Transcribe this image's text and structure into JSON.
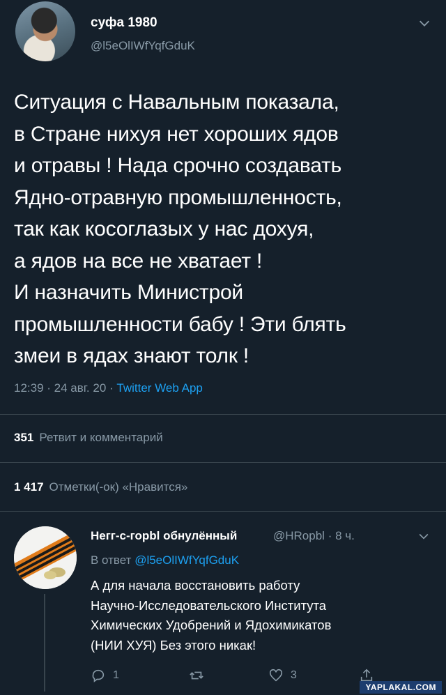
{
  "tweet": {
    "author_name": "суфа 1980",
    "author_handle": "@l5eOlIWfYqfGduK",
    "lines": [
      "Ситуация с Навальным показала,",
      "в Стране нихуя нет хороших ядов",
      "и отравы ! Нада срочно создавать",
      "Ядно-отравную промышленность,",
      "так как косоглазых у нас дохуя,",
      "а ядов на все не хватает !",
      "И назначить Министрой",
      "промышленности бабу ! Эти блять",
      "змеи в ядах знают толк !"
    ],
    "time": "12:39",
    "date": "24 авг. 20",
    "source": "Twitter Web App",
    "retweets_count": "351",
    "retweets_label": "Ретвит и комментарий",
    "likes_count": "1 417",
    "likes_label": "Отметки(-ок) «Нравится»"
  },
  "reply": {
    "author_name": "Негг-с-горbl обнулённый",
    "author_handle": "@HRopbl",
    "age": "8 ч.",
    "reply_to_label": "В ответ",
    "reply_to_handle": "@l5eOlIWfYqfGduK",
    "lines": [
      "А для начала восстановить работу",
      "Научно-Исследовательского Института",
      "Химических Удобрений и Ядохимикатов",
      "(НИИ ХУЯ) Без этого никак!"
    ],
    "reply_count": "1",
    "like_count": "3"
  },
  "watermark": "YAPLAKAL.COM",
  "icons": [
    "chevron-down-icon",
    "reply-icon",
    "retweet-icon",
    "like-icon",
    "share-icon"
  ],
  "colors": {
    "background": "#15202b",
    "muted": "#8899a6",
    "link": "#1da1f2",
    "divider": "#38444d"
  }
}
